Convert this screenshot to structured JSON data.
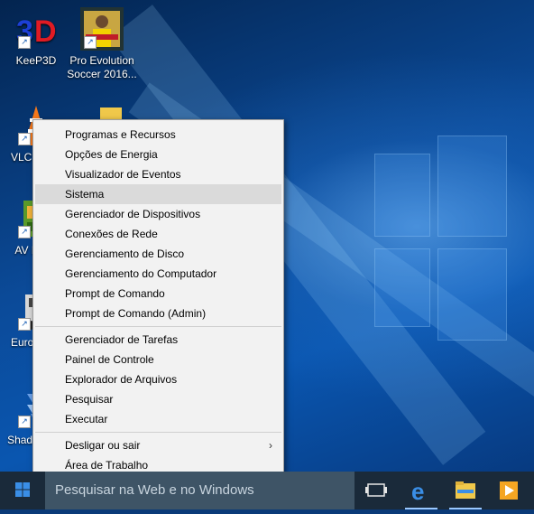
{
  "desktop": {
    "icons": [
      {
        "label": "KeeP3D",
        "icon": "keep3d-icon"
      },
      {
        "label": "Pro Evolution Soccer 2016...",
        "icon": "pes2016-icon"
      },
      {
        "label": "VLC m pla",
        "icon": "vlc-icon"
      },
      {
        "label": "AV Prote",
        "icon": "av-icon"
      },
      {
        "label": "Euro Simu",
        "icon": "euro-truck-icon"
      },
      {
        "label": "Shad The C",
        "icon": "shadow-icon"
      },
      {
        "label": "",
        "icon": "folder-icon"
      }
    ]
  },
  "context_menu": {
    "group1": [
      "Programas e Recursos",
      "Opções de Energia",
      "Visualizador de Eventos",
      "Sistema",
      "Gerenciador de Dispositivos",
      "Conexões de Rede",
      "Gerenciamento de Disco",
      "Gerenciamento do Computador",
      "Prompt de Comando",
      "Prompt de Comando (Admin)"
    ],
    "group2": [
      "Gerenciador de Tarefas",
      "Painel de Controle",
      "Explorador de Arquivos",
      "Pesquisar",
      "Executar"
    ],
    "group3": [
      "Desligar ou sair",
      "Área de Trabalho"
    ],
    "highlighted": "Sistema",
    "submenu_arrow": "›"
  },
  "taskbar": {
    "search_placeholder": "Pesquisar na Web e no Windows",
    "icons": [
      "windows-logo-icon",
      "task-view-icon",
      "edge-icon",
      "file-explorer-icon",
      "media-player-icon"
    ]
  },
  "colors": {
    "taskbar": "#1a2a3a",
    "search_box": "#3e5466",
    "menu_bg": "#f2f2f2",
    "menu_hover": "#dadada",
    "accent": "#0078d7"
  }
}
